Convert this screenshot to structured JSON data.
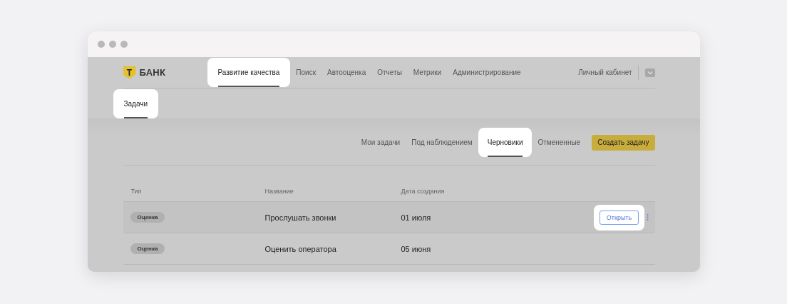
{
  "header": {
    "logo": {
      "mark": "Т",
      "text": "БАНК"
    },
    "nav": [
      {
        "label": "Развитие качества",
        "selected": true
      },
      {
        "label": "Поиск",
        "selected": false
      },
      {
        "label": "Автооценка",
        "selected": false
      },
      {
        "label": "Отчеты",
        "selected": false
      },
      {
        "label": "Метрики",
        "selected": false
      },
      {
        "label": "Администрирование",
        "selected": false
      }
    ],
    "account": "Личный кабинет"
  },
  "subnav": [
    {
      "label": "Задачи",
      "selected": true
    }
  ],
  "tabs": [
    {
      "label": "Мои задачи",
      "selected": false
    },
    {
      "label": "Под наблюдением",
      "selected": false
    },
    {
      "label": "Черновики",
      "selected": true
    },
    {
      "label": "Отмененные",
      "selected": false
    }
  ],
  "create_button": "Создать задачу",
  "table": {
    "columns": [
      "Тип",
      "Название",
      "Дата создания"
    ],
    "rows": [
      {
        "type": "Оценка",
        "name": "Прослушать звонки",
        "date": "01 июля",
        "hovered": true,
        "action": "Открыть"
      },
      {
        "type": "Оценка",
        "name": "Оценить оператора",
        "date": "05 июня",
        "hovered": false
      }
    ]
  }
}
